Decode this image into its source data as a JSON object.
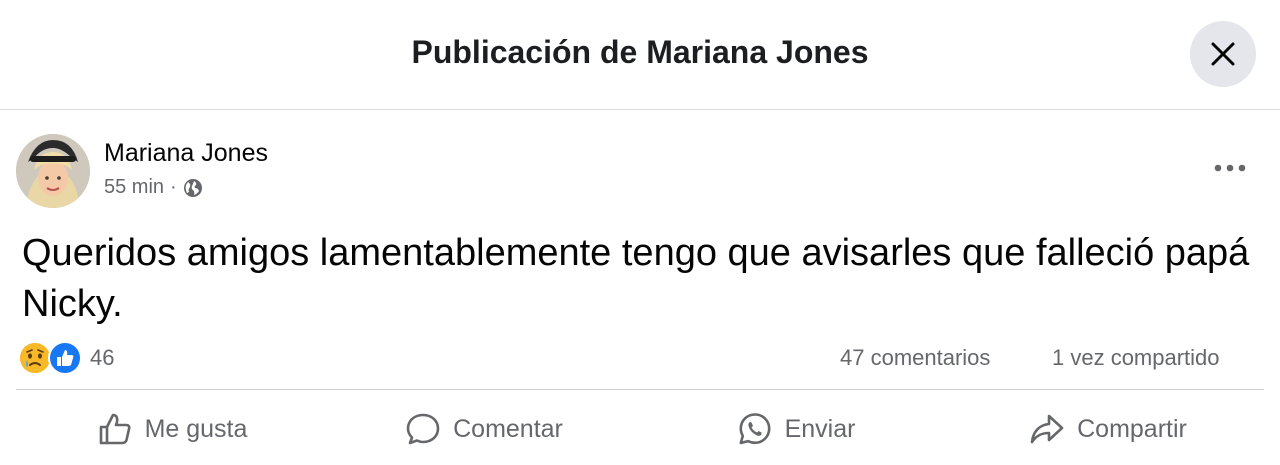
{
  "header": {
    "title": "Publicación de Mariana Jones"
  },
  "post": {
    "author": "Mariana Jones",
    "time": "55 min",
    "separator": "·",
    "audience_icon": "globe-icon",
    "text": "Queridos amigos lamentablemente tengo que avisarles que falleció papá Nicky."
  },
  "stats": {
    "reaction_icons": [
      "sad-face-icon",
      "like-icon"
    ],
    "reactions_count": "46",
    "comments": "47 comentarios",
    "shares": "1 vez compartido"
  },
  "actions": {
    "like": "Me gusta",
    "comment": "Comentar",
    "send": "Enviar",
    "share": "Compartir"
  },
  "colors": {
    "like_blue": "#1877f2",
    "sad_yellow": "#f7b928",
    "secondary_text": "#65676b",
    "divider": "#ced0d4"
  }
}
